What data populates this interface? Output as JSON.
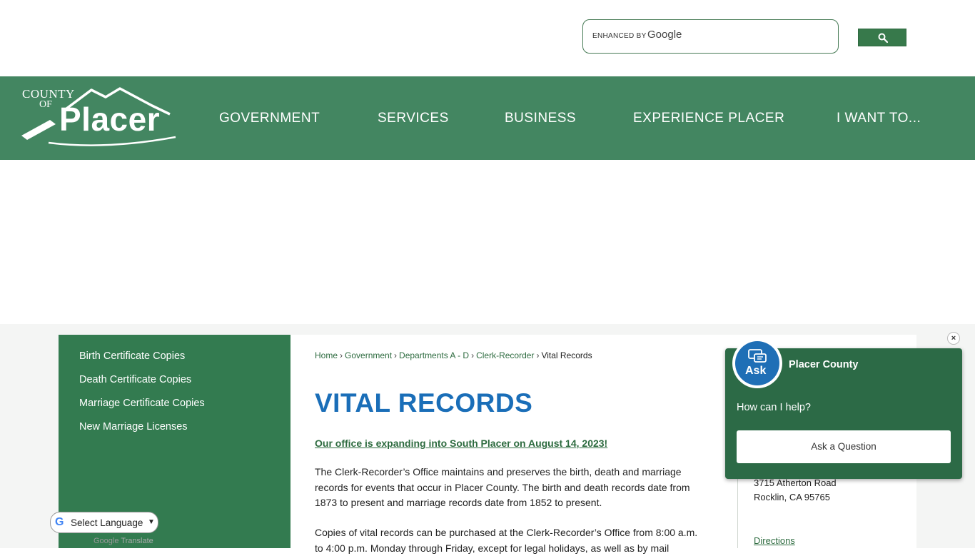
{
  "search": {
    "enhanced_by": "ENHANCED BY",
    "google": "Google",
    "button_icon": "search-icon"
  },
  "logo": {
    "county": "COUNTY",
    "of": "OF",
    "placer": "Placer"
  },
  "nav": {
    "items": [
      {
        "label": "GOVERNMENT"
      },
      {
        "label": "SERVICES"
      },
      {
        "label": "BUSINESS"
      },
      {
        "label": "EXPERIENCE PLACER"
      },
      {
        "label": "I WANT TO..."
      }
    ]
  },
  "sidebar": {
    "items": [
      {
        "label": "Birth Certificate Copies"
      },
      {
        "label": "Death Certificate Copies"
      },
      {
        "label": "Marriage Certificate Copies"
      },
      {
        "label": "New Marriage Licenses"
      }
    ]
  },
  "breadcrumb": {
    "items": [
      "Home",
      "Government",
      "Departments A - D",
      "Clerk-Recorder"
    ],
    "current": "Vital Records"
  },
  "page": {
    "title": "VITAL RECORDS",
    "notice": "Our office is expanding into South Placer on August 14, 2023!",
    "para1_lines": [
      "The Clerk-Recorder’s Office maintains and preserves the birth, death and marriage",
      "records for events that occur in Placer County.  The birth and death records date from",
      "1873 to present and marriage records date from 1852 to present."
    ],
    "para2_lines": [
      "Copies of vital records can be purchased at the Clerk-Recorder’s Office from 8:00 a.m.",
      "to 4:00 p.m. Monday through Friday, except for legal holidays, as well as by mail"
    ]
  },
  "contact": {
    "address1": "3715 Atherton Road",
    "address2": "Rocklin, CA 95765",
    "directions": "Directions"
  },
  "chat": {
    "avatar_label": "Ask",
    "name": "Placer County",
    "prompt": "How can I help?",
    "button": "Ask a Question",
    "close": "×"
  },
  "translate": {
    "label": "Select Language",
    "powered_by": "Powered by",
    "google": "Google",
    "translate": "Translate"
  },
  "colors": {
    "nav_green": "#438661",
    "sidebar_green": "#337b50",
    "title_blue": "#1a6eb8",
    "link_green": "#2d6b3f"
  }
}
